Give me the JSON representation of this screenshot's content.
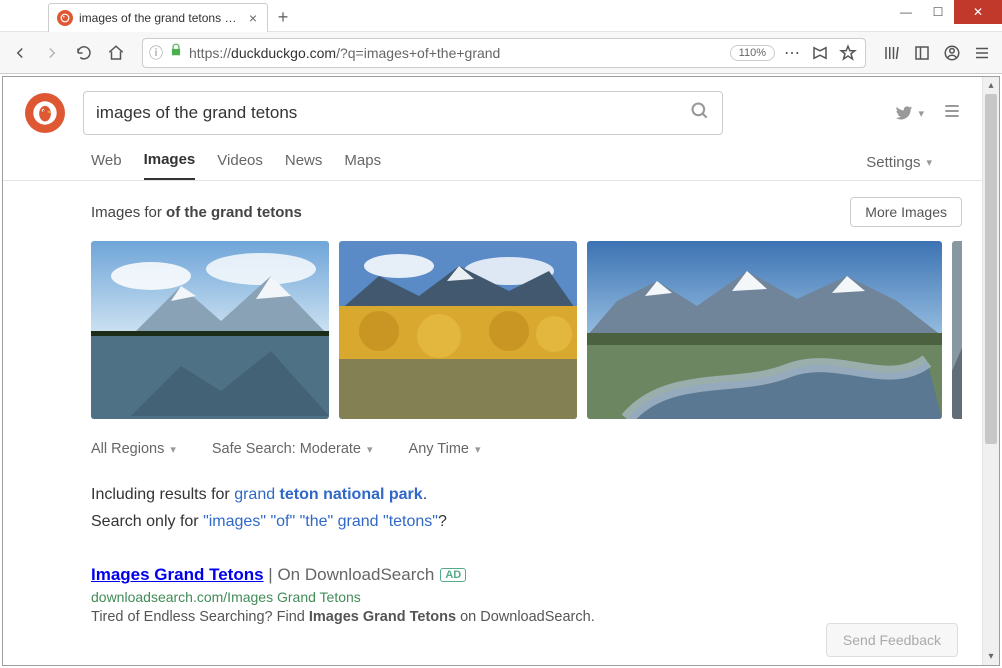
{
  "browser": {
    "tab_title": "images of the grand tetons at D",
    "new_tab": "+",
    "url_display_pre": "https://",
    "url_display_domain": "duckduckgo.com",
    "url_display_post": "/?q=images+of+the+grand",
    "zoom": "110%"
  },
  "search": {
    "query": "images of the grand tetons"
  },
  "tabs": {
    "items": [
      "Web",
      "Images",
      "Videos",
      "News",
      "Maps"
    ],
    "active_index": 1,
    "settings_label": "Settings"
  },
  "images_module": {
    "prefix": "Images for ",
    "bold": "of the grand tetons",
    "more": "More Images"
  },
  "filters": {
    "region": "All Regions",
    "safe": "Safe Search: Moderate",
    "time": "Any Time"
  },
  "hints": {
    "including_pre": "Including results for ",
    "including_link_a": "grand",
    "including_link_b": " teton national park",
    "search_only_pre": "Search only for ",
    "search_only_link": "\"images\" \"of\" \"the\" grand \"tetons\"",
    "q": "?"
  },
  "ad": {
    "title_main": "Images Grand Tetons",
    "title_sep": " | ",
    "title_sub": "On DownloadSearch",
    "badge": "AD",
    "url": "downloadsearch.com/Images Grand Tetons",
    "snip_a": "Tired of Endless Searching? Find ",
    "snip_b": "Images Grand Tetons",
    "snip_c": " on DownloadSearch."
  },
  "feedback": "Send Feedback"
}
